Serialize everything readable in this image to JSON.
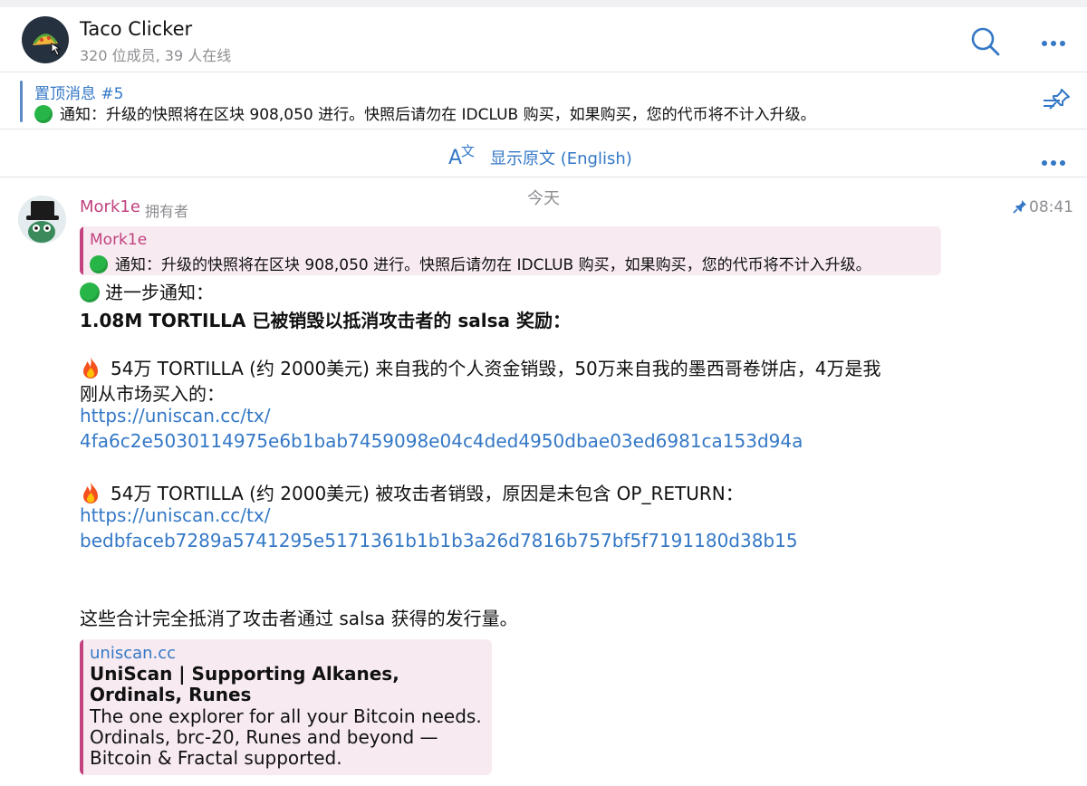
{
  "header": {
    "title": "Taco Clicker",
    "subtitle": "320 位成员, 39 人在线"
  },
  "pinned": {
    "title": "置顶消息 #5",
    "text": "通知：升级的快照将在区块 908,050 进行。快照后请勿在 IDCLUB 购买，如果购买，您的代币将不计入升级。"
  },
  "translate": {
    "label": "显示原文 (English)"
  },
  "chat": {
    "date": "今天",
    "message": {
      "sender": "Mork1e",
      "role": "拥有者",
      "time": "08:41",
      "reply": {
        "name": "Mork1e",
        "text": "通知：升级的快照将在区块 908,050 进行。快照后请勿在 IDCLUB 购买，如果购买，您的代币将不计入升级。"
      },
      "intro": "进一步通知：",
      "headline": "1.08M TORTILLA 已被销毁以抵消攻击者的 salsa 奖励：",
      "item1": {
        "text": "54万 TORTILLA (约 2000美元) 来自我的个人资金销毁，50万来自我的墨西哥卷饼店，4万是我",
        "text2": "刚从市场买入的：",
        "link1": "https://uniscan.cc/tx/",
        "link2": "4fa6c2e5030114975e6b1bab7459098e04c4ded4950dbae03ed6981ca153d94a"
      },
      "item2": {
        "text": "54万 TORTILLA (约 2000美元) 被攻击者销毁，原因是未包含 OP_RETURN：",
        "link1": "https://uniscan.cc/tx/",
        "link2": "bedbfaceb7289a5741295e5171361b1b1b3a26d7816b757bf5f7191180d38b15"
      },
      "summary": "这些合计完全抵消了攻击者通过 salsa 获得的发行量。",
      "preview": {
        "site": "uniscan.cc",
        "title": "UniScan | Supporting Alkanes, Ordinals, Runes",
        "description": "The one explorer for all your Bitcoin needs. Ordinals, brc-20, Runes and beyond — Bitcoin & Fractal supported."
      }
    }
  },
  "colors": {
    "accent": "#3478c6",
    "sender": "#c2427f",
    "quote_bg": "#f7ebf1",
    "status_dot": "#27b548"
  },
  "icons": {
    "search": "search-icon",
    "more": "more-dots-icon",
    "pinned_list": "pinned-list-icon",
    "translate": "translate-icon",
    "pin": "pin-icon",
    "fire": "fire-icon",
    "green_circle": "green-circle-icon"
  }
}
